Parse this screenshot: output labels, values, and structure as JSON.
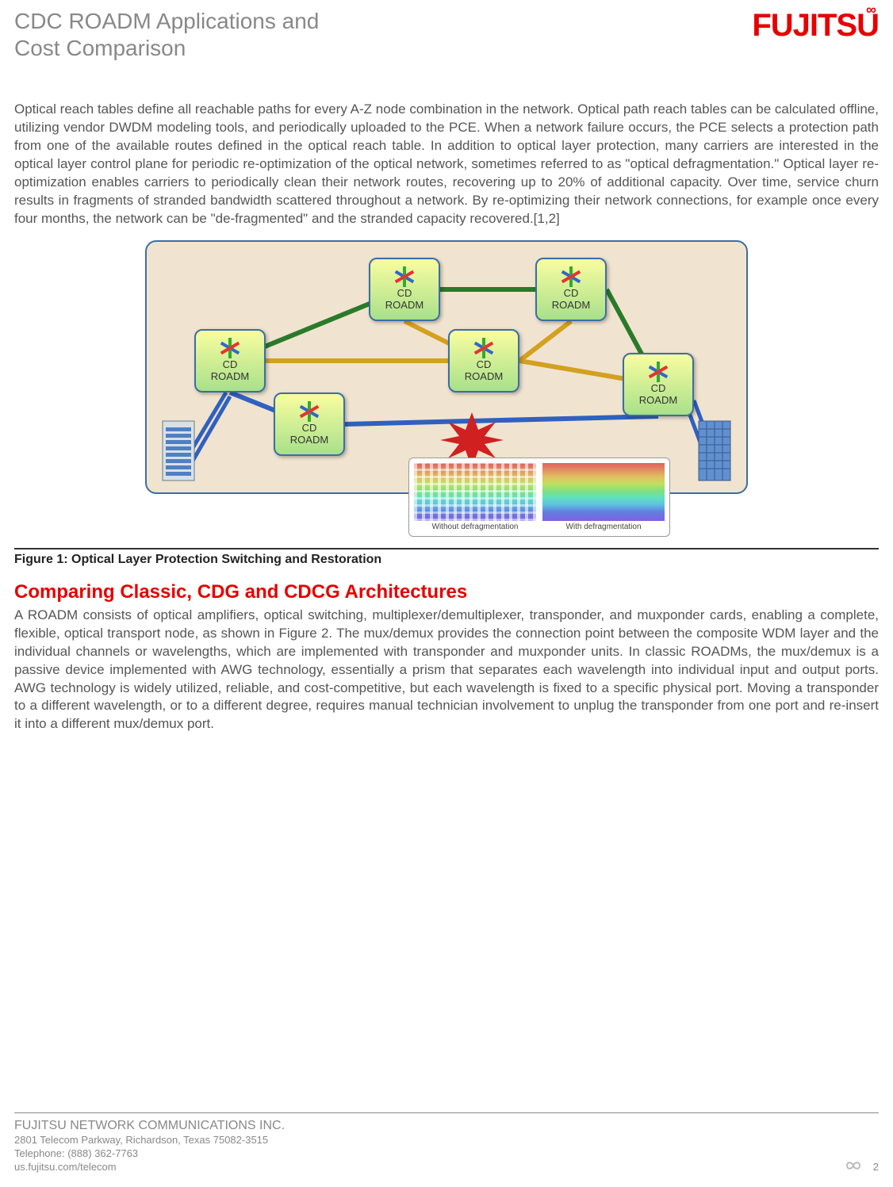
{
  "header": {
    "title_line1": "CDC ROADM Applications and",
    "title_line2": "Cost Comparison",
    "logo_text": "FUJITSU"
  },
  "paragraphs": {
    "intro": "Optical reach tables define all reachable paths for every A-Z node combination in the network. Optical path reach tables can be calculated offline, utilizing vendor DWDM modeling tools, and periodically uploaded to the PCE. When a network failure occurs, the PCE selects a protection path from one of the available routes defined in the optical reach table. In addition to optical layer protection, many carriers are interested in the optical layer control plane for periodic re-optimization of the optical network, sometimes referred to as \"optical defragmentation.\" Optical layer re-optimization enables carriers to periodically clean their network routes, recovering up to 20% of additional capacity. Over time, service churn results in fragments of stranded bandwidth scattered throughout a network. By re-optimizing their network connections, for example once every four months, the network can be \"de-fragmented\" and the stranded capacity recovered.[1,2]",
    "comparing": "A ROADM consists of optical amplifiers, optical switching, multiplexer/demultiplexer, transponder, and muxponder cards, enabling a complete, flexible, optical transport node, as shown in Figure 2. The mux/demux provides the connection point between the composite WDM layer and the individual channels or wavelengths, which are implemented with transponder and muxponder units. In classic ROADMs, the mux/demux is a passive device implemented with AWG technology, essentially a prism that separates each wavelength into individual input and output ports. AWG technology is widely utilized, reliable, and cost-competitive, but each wavelength is fixed to a specific physical port. Moving a transponder to a different wavelength, or to a different degree, requires manual technician involvement to unplug the transponder from one port and re-insert it into a different mux/demux port."
  },
  "diagram": {
    "node_label_line1": "CD",
    "node_label_line2": "ROADM",
    "chart_label_without": "Without defragmentation",
    "chart_label_with": "With defragmentation"
  },
  "captions": {
    "figure1": "Figure 1: Optical Layer Protection Switching and Restoration"
  },
  "headings": {
    "comparing": "Comparing Classic, CDG and CDCG Architectures"
  },
  "footer": {
    "company": "FUJITSU NETWORK COMMUNICATIONS INC.",
    "address": "2801 Telecom Parkway, Richardson, Texas 75082-3515",
    "telephone": "Telephone:  (888) 362-7763",
    "website": "us.fujitsu.com/telecom",
    "page_number": "2"
  }
}
